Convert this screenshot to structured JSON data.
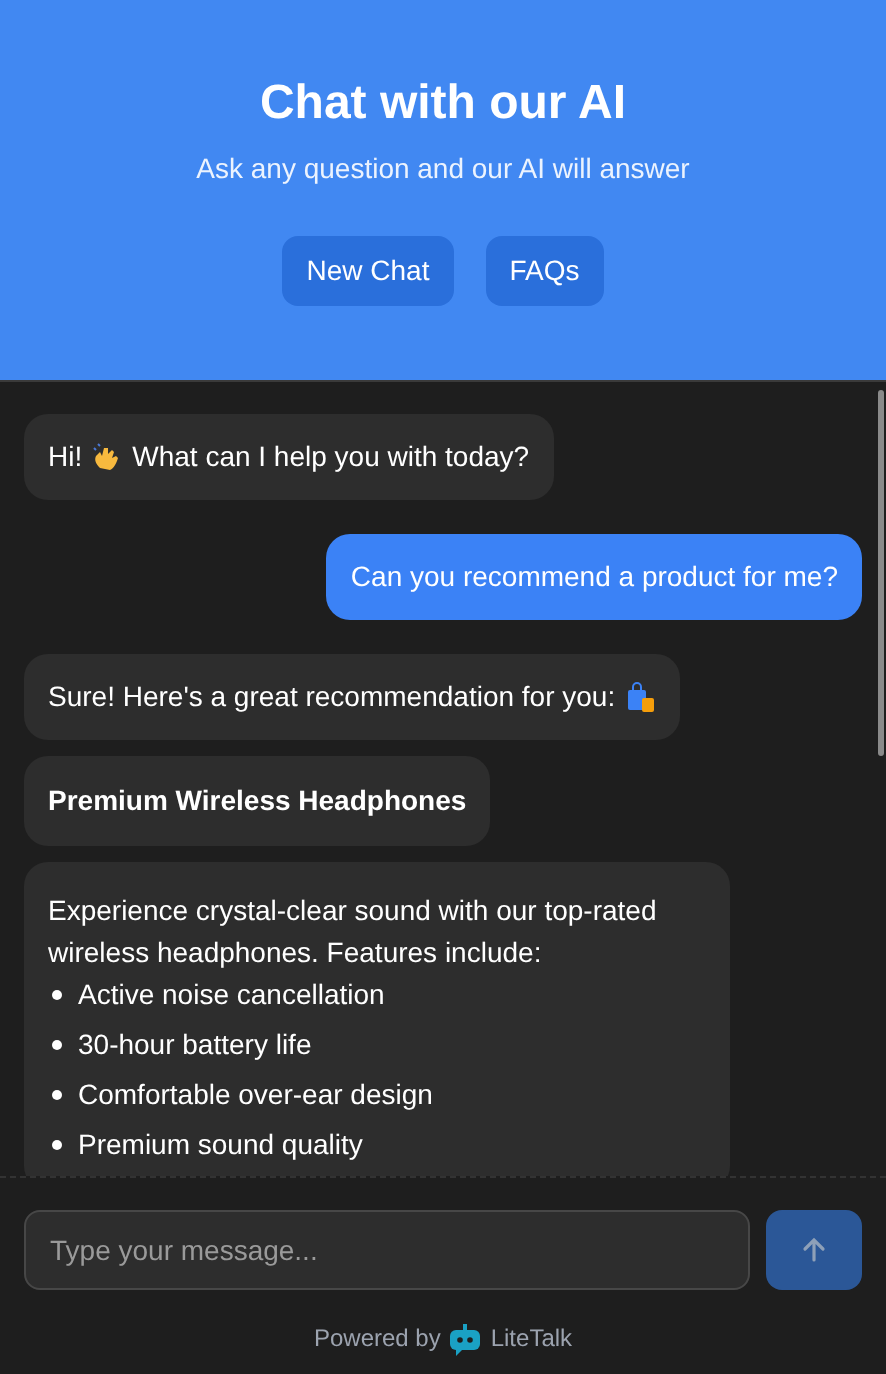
{
  "header": {
    "title": "Chat with our AI",
    "subtitle": "Ask any question and our AI will answer",
    "buttons": [
      "New Chat",
      "FAQs"
    ]
  },
  "messages": [
    {
      "kind": "greeting",
      "text_before": "Hi!",
      "text": "What can I help you with today?"
    },
    {
      "kind": "user",
      "text": "Can you recommend a product for me?"
    },
    {
      "kind": "recommendation",
      "text": "Sure! Here's a great recommendation for you:"
    },
    {
      "kind": "title",
      "text": "Premium Wireless Headphones"
    },
    {
      "kind": "list",
      "text": "Experience crystal-clear sound with our top-rated wireless headphones. Features include:",
      "items": [
        "Active noise cancellation",
        "30-hour battery life",
        "Comfortable over-ear design",
        "Premium sound quality"
      ]
    }
  ],
  "composer": {
    "placeholder": "Type your message...",
    "send_disabled": true
  },
  "footer": {
    "prefix": "Powered by",
    "brand": "LiteTalk"
  }
}
